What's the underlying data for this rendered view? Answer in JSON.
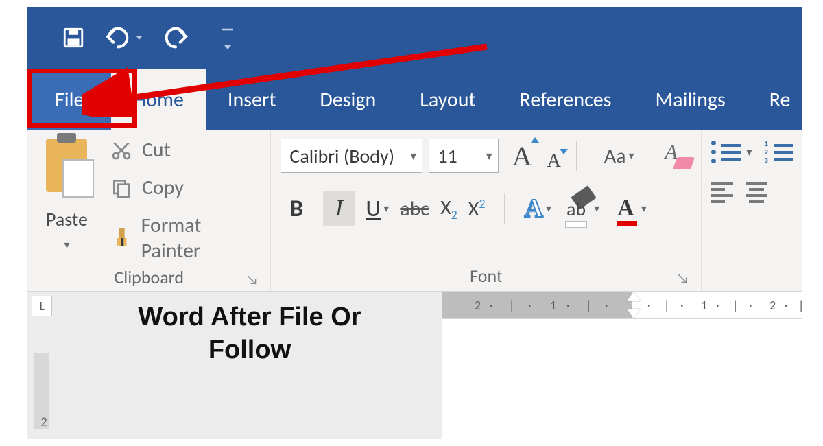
{
  "quick_access": {
    "save": "Save",
    "undo": "Undo",
    "redo": "Redo",
    "customize": "Customize"
  },
  "tabs": {
    "file": "File",
    "home": "Home",
    "insert": "Insert",
    "design": "Design",
    "layout": "Layout",
    "references": "References",
    "mailings": "Mailings",
    "review": "Re"
  },
  "clipboard": {
    "paste": "Paste",
    "cut": "Cut",
    "copy": "Copy",
    "format_painter": "Format Painter",
    "group_label": "Clipboard"
  },
  "font": {
    "font_name": "Calibri (Body)",
    "font_size": "11",
    "grow": "A",
    "shrink": "A",
    "change_case": "Aa",
    "clear": "A",
    "bold": "B",
    "italic": "I",
    "underline": "U",
    "strike": "abc",
    "subscript_base": "X",
    "subscript_sub": "2",
    "superscript_base": "X",
    "superscript_sup": "2",
    "effects": "A",
    "highlight": "ab",
    "color": "A",
    "group_label": "Font"
  },
  "paragraph": {
    "num1": "1",
    "num2": "2",
    "num3": "3"
  },
  "ruler": {
    "left_labels": [
      "2",
      "1"
    ],
    "right_labels": [
      "1",
      "2"
    ]
  },
  "vertical_ruler": {
    "label": "2"
  },
  "tab_selector": "L",
  "overlay_text_line1": "Word After File Or",
  "overlay_text_line2": "Follow",
  "annotation": {
    "highlight_color": "#e10000"
  }
}
